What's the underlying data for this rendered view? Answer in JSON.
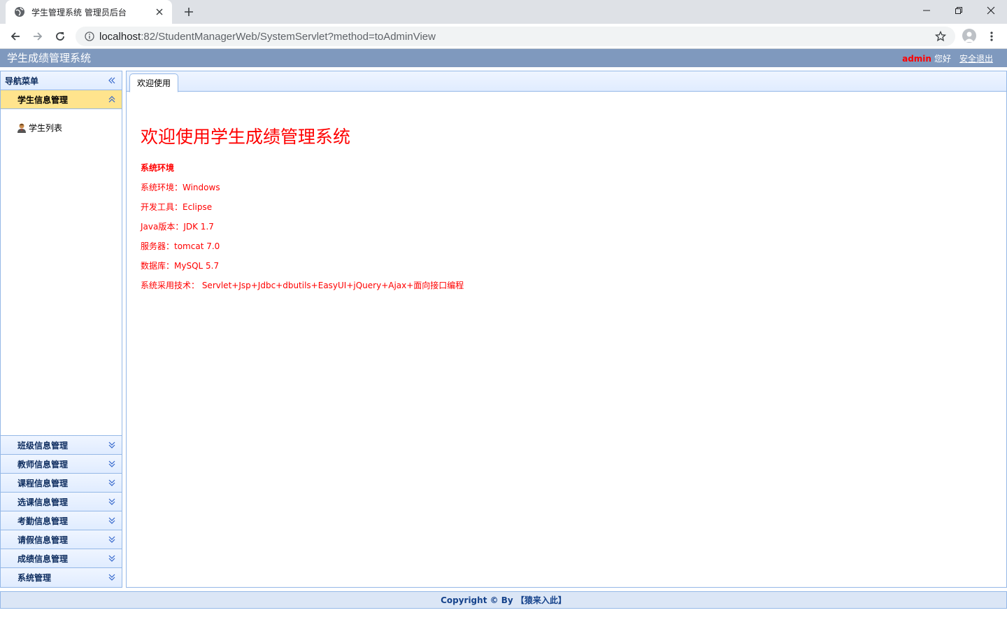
{
  "browser": {
    "tab_title": "学生管理系统 管理员后台",
    "url_host": "localhost",
    "url_rest": ":82/StudentManagerWeb/SystemServlet?method=toAdminView",
    "icons": [
      "globe-icon",
      "close-icon",
      "plus-icon",
      "minimize-icon",
      "restore-icon",
      "close-window-icon",
      "back-icon",
      "forward-icon",
      "reload-icon",
      "info-icon",
      "star-icon",
      "profile-icon",
      "more-icon"
    ]
  },
  "header": {
    "title": "学生成绩管理系统",
    "username": "admin",
    "greeting": "您好",
    "logout": "安全退出"
  },
  "nav": {
    "title": "导航菜单",
    "open_section": {
      "label": "学生信息管理",
      "items": [
        {
          "label": "学生列表",
          "icon": "user-icon"
        }
      ]
    },
    "sections": [
      {
        "label": "班级信息管理"
      },
      {
        "label": "教师信息管理"
      },
      {
        "label": "课程信息管理"
      },
      {
        "label": "选课信息管理"
      },
      {
        "label": "考勤信息管理"
      },
      {
        "label": "请假信息管理"
      },
      {
        "label": "成绩信息管理"
      },
      {
        "label": "系统管理"
      }
    ]
  },
  "main": {
    "tab_label": "欢迎使用",
    "welcome": "欢迎使用学生成绩管理系统",
    "env_title": "系统环境",
    "env_lines": [
      "系统环境：Windows",
      "开发工具：Eclipse",
      "Java版本：JDK 1.7",
      "服务器：tomcat 7.0",
      "数据库：MySQL 5.7",
      "系统采用技术： Servlet+Jsp+Jdbc+dbutils+EasyUI+jQuery+Ajax+面向接口编程"
    ]
  },
  "footer": {
    "text": "Copyright © By 【猿来入此】"
  },
  "colors": {
    "header_bg": "#7f99be",
    "accent_red": "#ff0000",
    "panel_border": "#95b8e7",
    "active_section_bg": "#ffe48d",
    "footer_text": "#15428b"
  }
}
